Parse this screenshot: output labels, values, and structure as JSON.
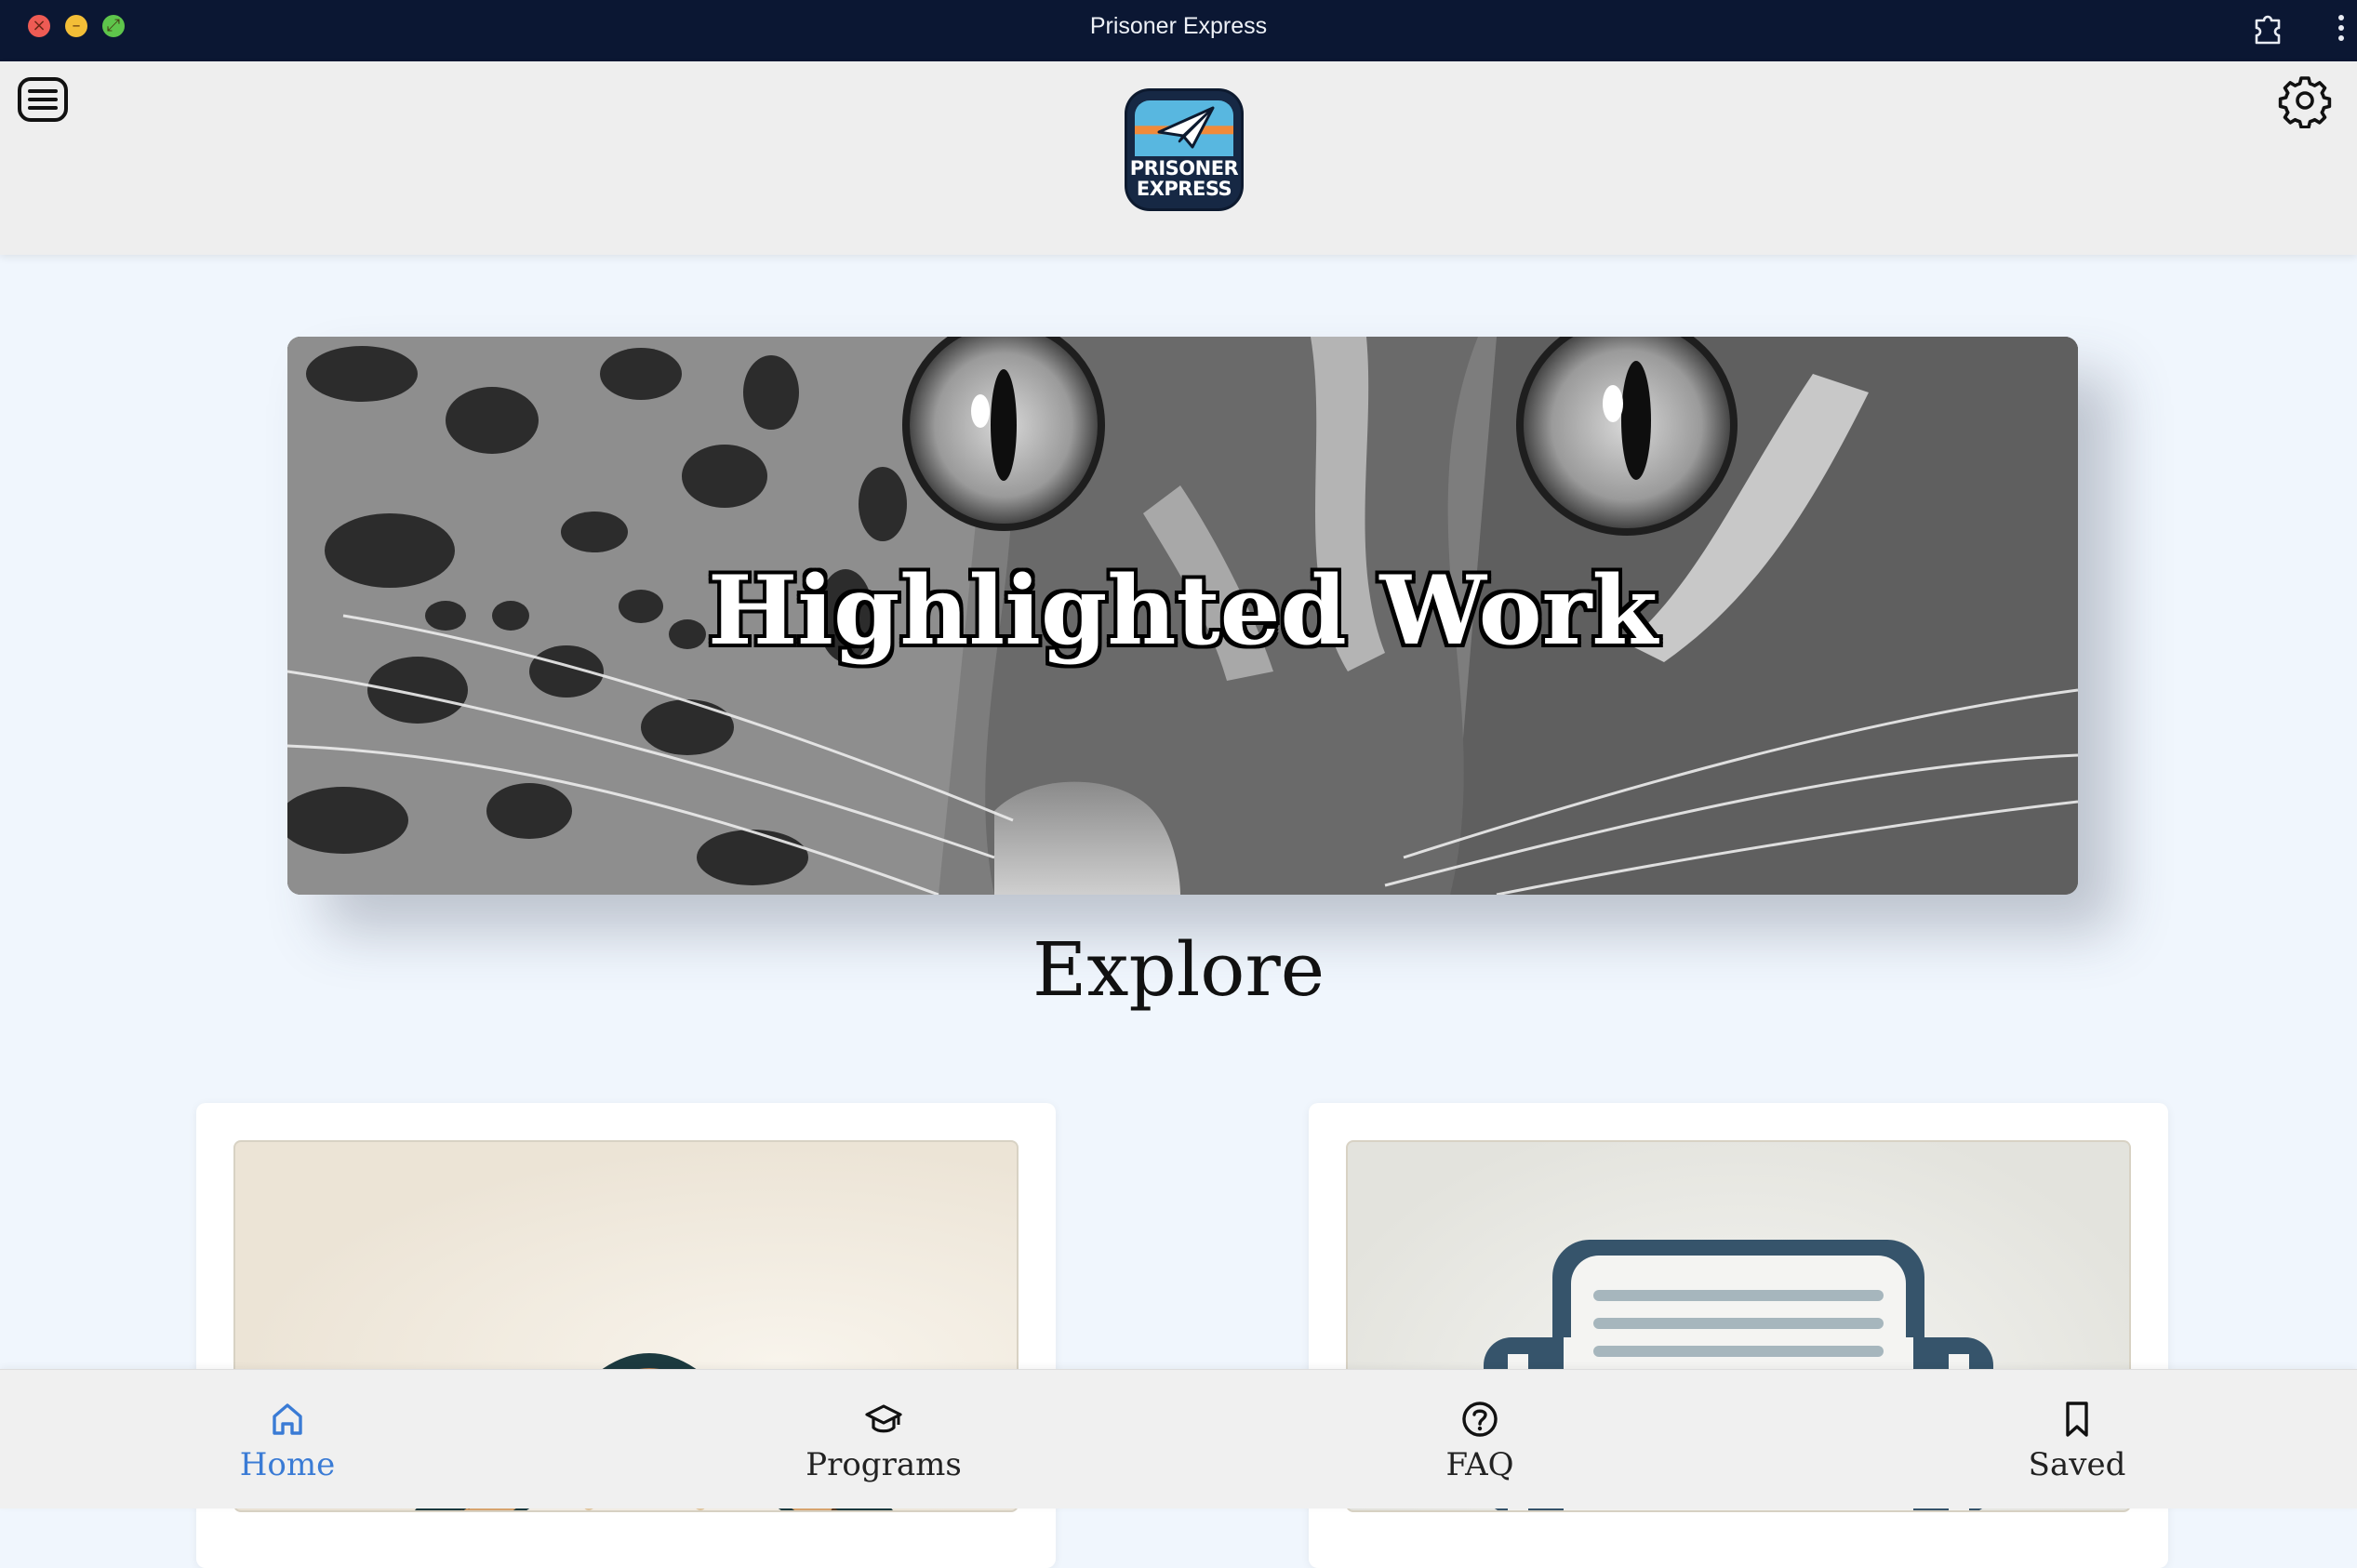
{
  "window": {
    "title": "Prisoner Express"
  },
  "header": {
    "logo_line1": "PRISONER",
    "logo_line2": "EXPRESS",
    "menu_icon": "hamburger-menu-icon",
    "settings_icon": "gear-icon"
  },
  "hero": {
    "title": "Highlighted Work"
  },
  "main": {
    "section_heading": "Explore",
    "cards": [
      {
        "image": "book-illustration"
      },
      {
        "image": "newsletter-printer-illustration"
      }
    ]
  },
  "bottom_nav": {
    "items": [
      {
        "label": "Home",
        "icon": "home-icon",
        "active": true
      },
      {
        "label": "Programs",
        "icon": "graduation-cap-icon",
        "active": false
      },
      {
        "label": "FAQ",
        "icon": "question-circle-icon",
        "active": false
      },
      {
        "label": "Saved",
        "icon": "bookmark-icon",
        "active": false
      }
    ]
  },
  "colors": {
    "titlebar": "#0b1733",
    "page_background": "#f0f6fd",
    "header_background": "#eeeeee",
    "active_nav": "#3a7bd5"
  }
}
